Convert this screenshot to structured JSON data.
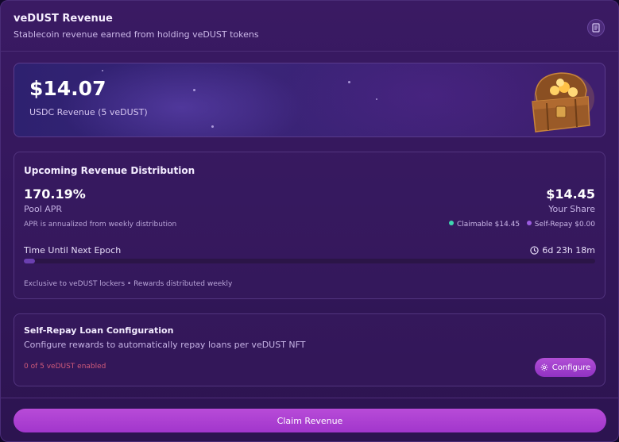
{
  "header": {
    "title": "veDUST Revenue",
    "subtitle": "Stablecoin revenue earned from holding veDUST tokens",
    "doc_icon": "document-icon"
  },
  "hero": {
    "amount": "$14.07",
    "label": "USDC Revenue (5 veDUST)",
    "image_icon": "treasure-chest-icon"
  },
  "distribution": {
    "title": "Upcoming Revenue Distribution",
    "apr_value": "170.19%",
    "apr_label": "Pool APR",
    "share_value": "$14.45",
    "share_label": "Your Share",
    "apr_note": "APR is annualized from weekly distribution",
    "claimable": "Claimable $14.45",
    "self_repay": "Self-Repay $0.00",
    "epoch_label": "Time Until Next Epoch",
    "epoch_time": "6d 23h 18m",
    "epoch_progress": 0.02,
    "footer_note": "Exclusive to veDUST lockers • Rewards distributed weekly"
  },
  "self_repay": {
    "title": "Self-Repay Loan Configuration",
    "description": "Configure rewards to automatically repay loans per veDUST NFT",
    "status": "0 of 5 veDUST enabled",
    "configure_label": "Configure"
  },
  "claim_label": "Claim Revenue",
  "colors": {
    "claimable_dot": "#3fd6b0",
    "self_repay_dot": "#9b5ce0",
    "status_text": "#d05a7a",
    "accent": "#a63ad0"
  }
}
